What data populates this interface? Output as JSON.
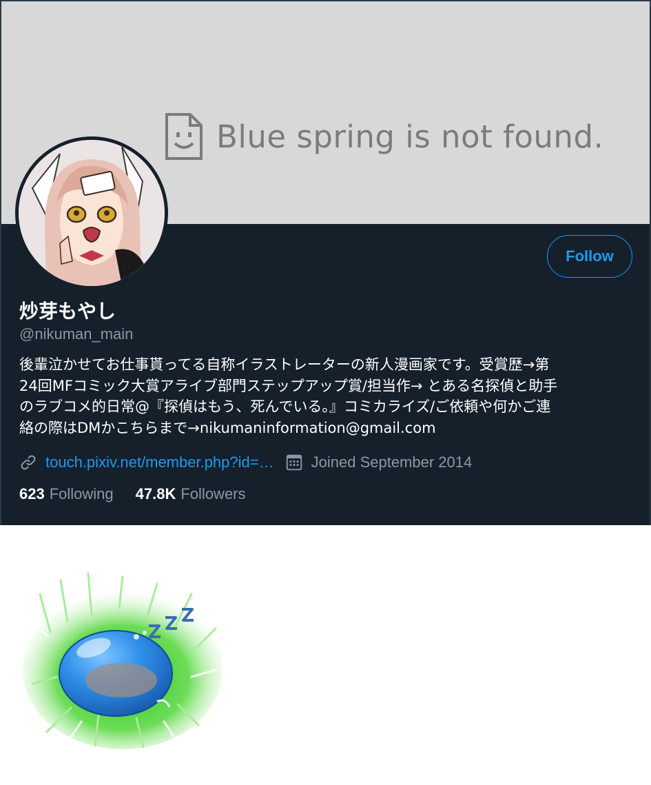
{
  "banner": {
    "message": "Blue spring is not found.",
    "icon": "broken-image-face-icon"
  },
  "profile": {
    "display_name": "炒芽もやし",
    "handle": "@nikuman_main",
    "bio_lines": [
      "後輩泣かせてお仕事貰ってる自称イラストレーターの新人漫画家です。受賞歴→第",
      "24回MFコミック大賞アライブ部門ステップアップ賞/担当作→ とある名探偵と助手",
      "のラブコメ的日常@『探偵はもう、死んでいる。』コミカライズ/ご依頼や何かご連",
      "絡の際はDMかこちらまで→nikumaninformation@gmail.com"
    ],
    "website": "touch.pixiv.net/member.php?id=…",
    "joined": "Joined September 2014",
    "following_count": "623",
    "following_label": "Following",
    "followers_count": "47.8K",
    "followers_label": "Followers"
  },
  "actions": {
    "follow_label": "Follow"
  },
  "icons": {
    "link": "link-icon",
    "calendar": "calendar-icon"
  },
  "colors": {
    "background": "#15202b",
    "accent": "#1d9bf0",
    "muted": "#8899a6",
    "banner": "#d8d8d8"
  }
}
